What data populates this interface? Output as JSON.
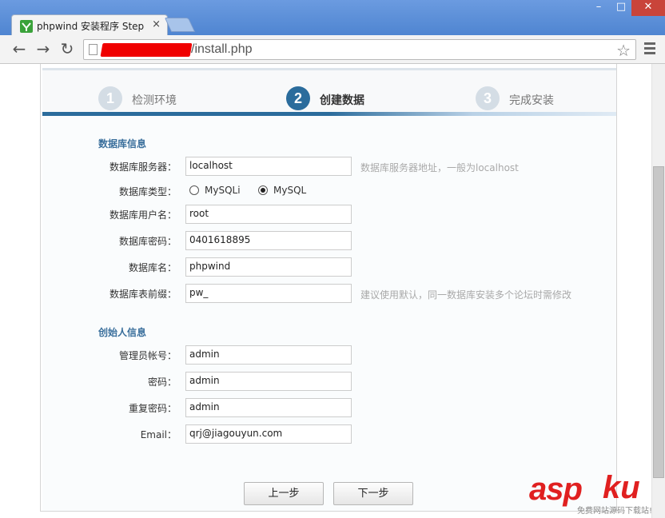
{
  "browser": {
    "tab_title": "phpwind 安装程序 Step",
    "tab_close": "×",
    "url": "/install.php",
    "window_buttons": {
      "minimize": "–",
      "maximize": "□",
      "close": "✕"
    },
    "nav": {
      "back": "←",
      "forward": "→",
      "reload": "↻",
      "star": "☆"
    }
  },
  "steps": [
    {
      "num": "1",
      "label": "检测环境",
      "active": false
    },
    {
      "num": "2",
      "label": "创建数据",
      "active": true
    },
    {
      "num": "3",
      "label": "完成安装",
      "active": false
    }
  ],
  "database_section": {
    "title": "数据库信息",
    "server": {
      "label": "数据库服务器：",
      "value": "localhost",
      "hint": "数据库服务器地址，一般为localhost"
    },
    "type": {
      "label": "数据库类型：",
      "options": [
        "MySQLi",
        "MySQL"
      ],
      "selected": "MySQL"
    },
    "user": {
      "label": "数据库用户名：",
      "value": "root"
    },
    "password": {
      "label": "数据库密码：",
      "value": "0401618895"
    },
    "name": {
      "label": "数据库名：",
      "value": "phpwind"
    },
    "prefix": {
      "label": "数据库表前缀：",
      "value": "pw_",
      "hint": "建议使用默认，同一数据库安装多个论坛时需修改"
    }
  },
  "founder_section": {
    "title": "创始人信息",
    "admin": {
      "label": "管理员帐号：",
      "value": "admin"
    },
    "password": {
      "label": "密码：",
      "value": "admin"
    },
    "repeat_password": {
      "label": "重复密码：",
      "value": "admin"
    },
    "email": {
      "label": "Email：",
      "value": "qrj@jiagouyun.com"
    }
  },
  "buttons": {
    "prev": "上一步",
    "next": "下一步"
  },
  "watermark": {
    "brand_a": "asp",
    "brand_b": "ku",
    "tagline": "免费网站源码下载站!"
  },
  "colors": {
    "accent": "#2b6c9c",
    "section_title": "#3a6f9c",
    "hint": "#a9a9a9",
    "watermark": "#e02020"
  }
}
